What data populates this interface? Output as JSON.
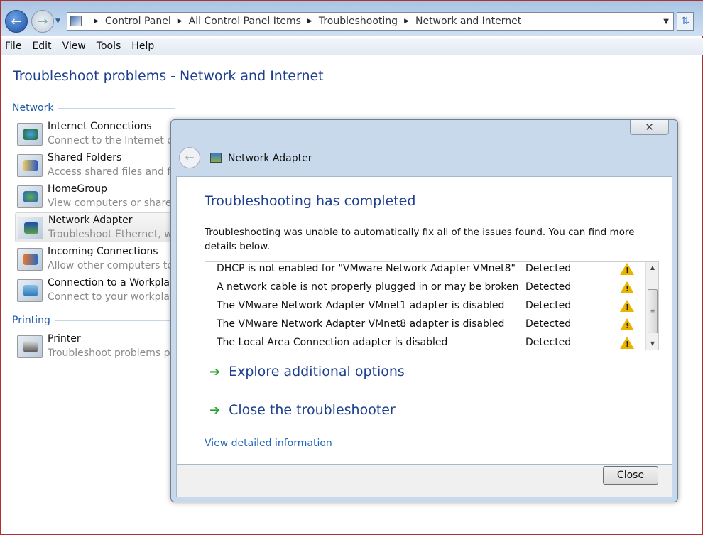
{
  "explorer": {
    "breadcrumb": [
      "Control Panel",
      "All Control Panel Items",
      "Troubleshooting",
      "Network and Internet"
    ],
    "menu": [
      "File",
      "Edit",
      "View",
      "Tools",
      "Help"
    ],
    "page_title": "Troubleshoot problems - Network and Internet",
    "sections": {
      "network": "Network",
      "printing": "Printing"
    },
    "items": [
      {
        "title": "Internet Connections",
        "desc": "Connect to the Internet or"
      },
      {
        "title": "Shared Folders",
        "desc": "Access shared files and fol"
      },
      {
        "title": "HomeGroup",
        "desc": "View computers or shared"
      },
      {
        "title": "Network Adapter",
        "desc": "Troubleshoot Ethernet, wir"
      },
      {
        "title": "Incoming Connections",
        "desc": "Allow other computers to"
      },
      {
        "title": "Connection to a Workplac",
        "desc": "Connect to your workplace"
      },
      {
        "title": "Printer",
        "desc": "Troubleshoot problems pr"
      }
    ]
  },
  "dialog": {
    "title": "Network Adapter",
    "heading": "Troubleshooting has completed",
    "message": "Troubleshooting was unable to automatically fix all of the issues found. You can find more details below.",
    "issues": [
      {
        "problem": "DHCP is not enabled for \"VMware Network Adapter VMnet8\"",
        "status": "Detected"
      },
      {
        "problem": "A network cable is not properly plugged in or may be broken",
        "status": "Detected"
      },
      {
        "problem": "The VMware Network Adapter VMnet1 adapter is disabled",
        "status": "Detected"
      },
      {
        "problem": "The VMware Network Adapter VMnet8 adapter is disabled",
        "status": "Detected"
      },
      {
        "problem": "The Local Area Connection adapter is disabled",
        "status": "Detected"
      }
    ],
    "options": [
      "Explore additional options",
      "Close the troubleshooter"
    ],
    "detail_link": "View detailed information",
    "close_label": "Close"
  }
}
